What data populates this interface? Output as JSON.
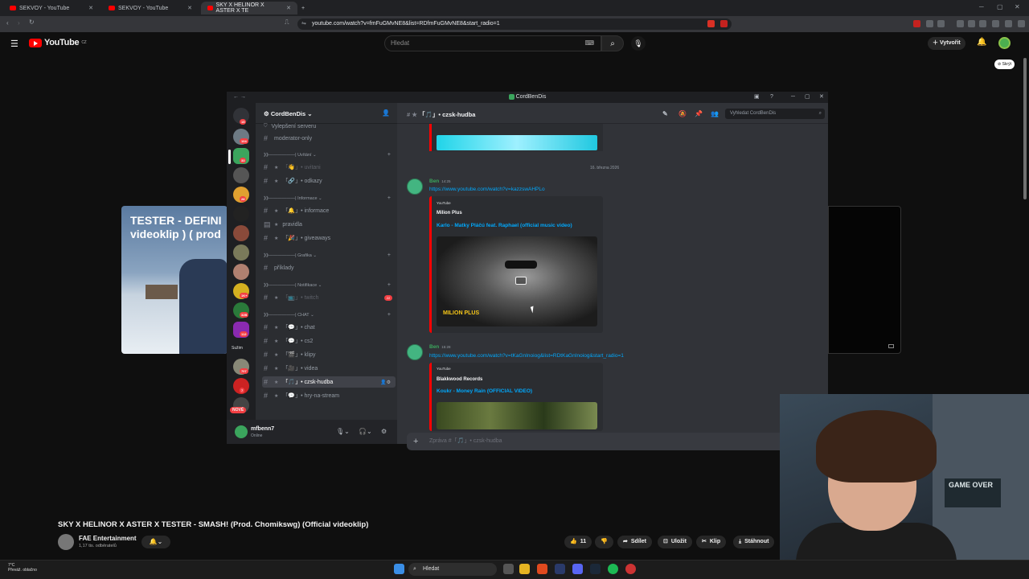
{
  "browser": {
    "tabs": [
      {
        "label": "SEKVOY - YouTube"
      },
      {
        "label": "SEKVOY - YouTube"
      },
      {
        "label": "SKY X HELINOR X ASTER X TE"
      }
    ],
    "url": "youtube.com/watch?v=fmFuGMvNE8&list=RDfmFuGMvNE8&start_radio=1"
  },
  "youtube": {
    "logo_text": "YouTube",
    "logo_region": "CZ",
    "search_placeholder": "Hledat",
    "create_label": "Vytvořit",
    "hide_chip": "Skrýt",
    "video_overlay_title": "TESTER - DEFINI videoklip ) ( prod",
    "video_title": "SKY X HELINOR X ASTER X TESTER - SMASH! (Prod. Chomikswg) (Official videoklip)",
    "channel_name": "FAE Entertainment",
    "channel_subs": "1,17 tis. odběratelů",
    "like_count": "11",
    "share_label": "Sdílet",
    "save_label": "Uložit",
    "clip_label": "Klip",
    "download_label": "Stáhnout"
  },
  "discord": {
    "window_title": "CordBenDis",
    "server_name": "CordBenDis",
    "guild_badges": [
      "15",
      "104",
      "33",
      "28",
      "1K+",
      "32B",
      "112",
      "707",
      "7"
    ],
    "guild_labels": [
      "Sužim",
      "NOVÉ"
    ],
    "channels": {
      "boost": "Vylepšení serveru",
      "moderator": "moderator-only",
      "cat_uvitani": "⟫⟫——————| Uvítání",
      "uvitani": "「👋」• uvitani",
      "odkazy": "「🔗」• odkazy",
      "cat_informace": "⟫⟫——————| Informace",
      "informace": "「🔔」• informace",
      "pravidla": "pravidla",
      "giveaways": "「🎉」• giveaways",
      "cat_grafika": "⟫⟫——————| Grafika",
      "priklady": "příklady",
      "cat_notifikace": "⟫⟫——————| Notifikace",
      "twitch": "「📺」• twitch",
      "twitch_badge": "22",
      "cat_chat": "⟫⟫——————| CHAT",
      "chat": "「💬」• chat",
      "cs2": "「💬」• cs2",
      "klipy": "「🎬」• klipy",
      "videa": "「🎥」• videa",
      "czsk": "「🎵」• czsk-hudba",
      "hry": "「💬」• hry-na-stream"
    },
    "header_channel": "「🎵」• czsk-hudba",
    "search_placeholder": "Vyhledat CordBenDis",
    "date_divider": "16. března 2026",
    "messages": [
      {
        "author": "Ben",
        "time": "14:25",
        "link": "https://www.youtube.com/watch?v=kazzswAHPLo",
        "provider": "YouTube",
        "embed_author": "Milion Plus",
        "embed_title": "Karlo - Matky Pláčú feat. Raphael (official music video)",
        "thumb_text": "MILION PLUS"
      },
      {
        "author": "Ben",
        "time": "15:28",
        "link": "https://www.youtube.com/watch?v=tKaGnInoiog&list=RDtKaGnInoiog&start_radio=1",
        "provider": "YouTube",
        "embed_author": "Blakkwood Records",
        "embed_title": "Koukr - Money Rain (OFFICIAL VIDEO)"
      }
    ],
    "composer_placeholder": "Zpráva #「🎵」• czsk-hudba",
    "user_name": "mfbenn7",
    "user_status": "Online"
  },
  "webcam": {
    "sign_text": "GAME OVER"
  },
  "taskbar": {
    "temp": "7°C",
    "weather": "Převáž. oblačno",
    "search": "Hledat"
  }
}
